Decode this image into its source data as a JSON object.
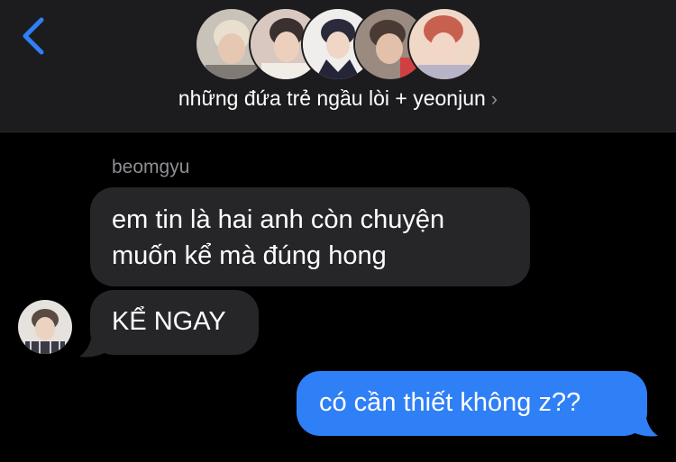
{
  "header": {
    "back_icon": "chevron-left-icon",
    "group_name": "những đứa trẻ ngầu lòi + yeonjun",
    "disclosure_icon": "chevron-right-icon",
    "avatars": [
      {
        "icon": "avatar-photo",
        "bg": "#c9c2b8",
        "accent": "#e8dfcf"
      },
      {
        "icon": "avatar-photo",
        "bg": "#d8c8c0",
        "accent": "#3a3030"
      },
      {
        "icon": "avatar-photo",
        "bg": "#f0eeec",
        "accent": "#2a2a3a"
      },
      {
        "icon": "avatar-photo",
        "bg": "#9a8a80",
        "accent": "#d04040"
      },
      {
        "icon": "avatar-photo",
        "bg": "#c86050",
        "accent": "#f0d8c8"
      }
    ]
  },
  "messages": {
    "sender_name": "beomgyu",
    "incoming_1_line_1": "em tin là hai anh còn chuyện",
    "incoming_1_line_2": "muốn kể mà đúng hong",
    "incoming_2": "KỂ NGAY",
    "outgoing_1": "có cần thiết không z??"
  },
  "colors": {
    "background": "#000000",
    "header_bg": "#1c1c1e",
    "incoming_bubble": "#262629",
    "outgoing_bubble": "#2f7ff6",
    "accent_blue": "#2f7ff6",
    "secondary_text": "#8e8e93"
  }
}
